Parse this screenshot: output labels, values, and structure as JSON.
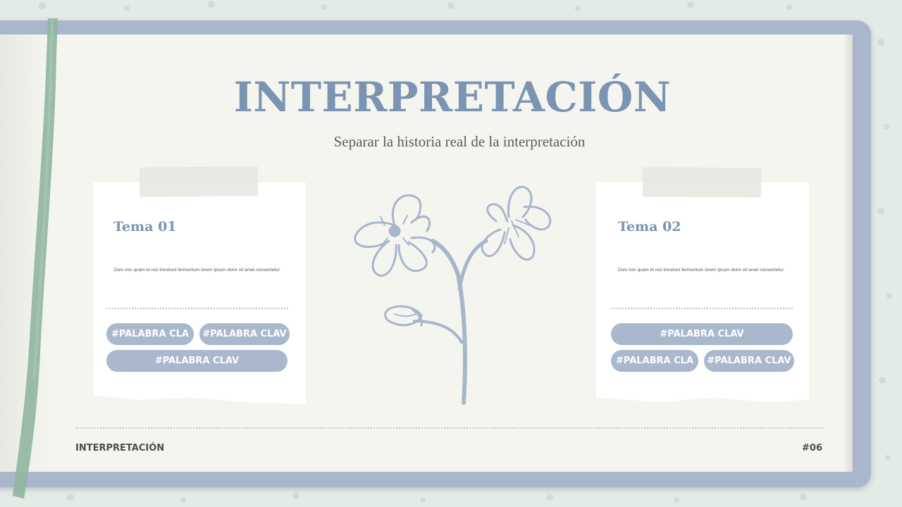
{
  "slide": {
    "title": "INTERPRETACIÓN",
    "subtitle": "Separar la historia real de la interpretación"
  },
  "cards": [
    {
      "title": "Tema 01",
      "text": "Duis non quam et nisi tincidunt fermentum lorem ipsum dolor sit amet consectetur.",
      "tags": [
        "#PALABRA CLA",
        "#PALABRA CLAV",
        "#PALABRA CLAV"
      ]
    },
    {
      "title": "Tema 02",
      "text": "Duis non quam et nisi tincidunt fermentum lorem ipsum dolor sit amet consectetur.",
      "tags": [
        "#PALABRA CLAV",
        "#PALABRA CLA",
        "#PALABRA CLAV"
      ]
    }
  ],
  "footer": {
    "left": "INTERPRETACIÓN",
    "right": "#06"
  },
  "colors": {
    "accent": "#7a94b1",
    "pill": "#a9b8cc",
    "page": "#f5f5f0",
    "frame": "#a9b6cb",
    "ribbon": "#8fb5a0",
    "background": "#e3ebe7"
  },
  "icons": [
    "flower-illustration",
    "bookmark-ribbon"
  ]
}
